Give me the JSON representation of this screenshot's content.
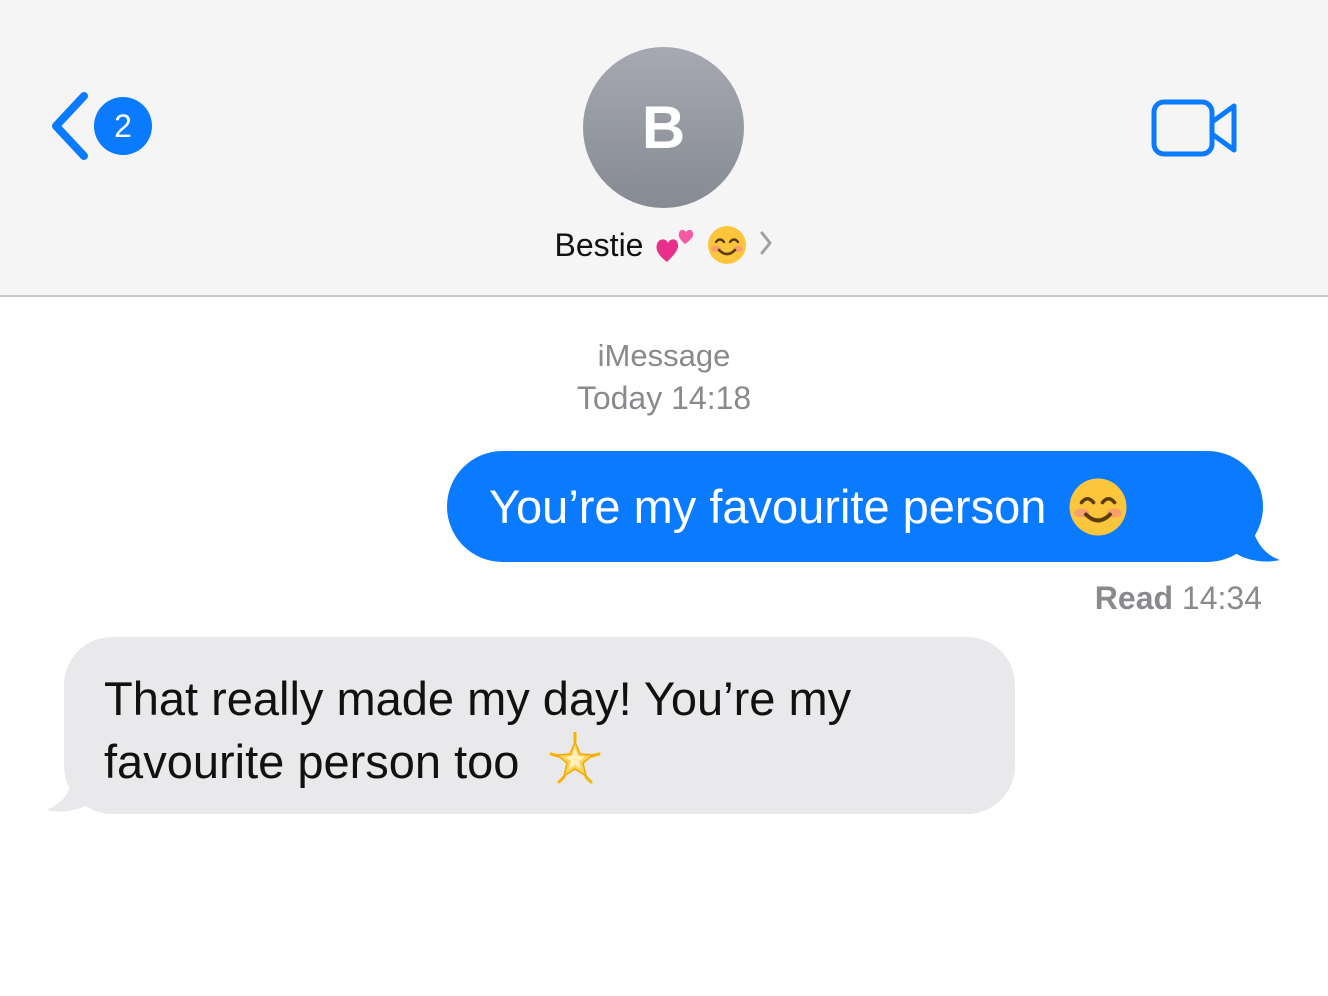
{
  "header": {
    "back_badge_count": "2",
    "avatar_initial": "B",
    "contact_name": "Bestie",
    "contact_emojis": [
      "two-hearts-emoji",
      "smiling-face-emoji"
    ],
    "icons": [
      "chevron-left-icon",
      "chevron-right-icon",
      "video-camera-icon"
    ],
    "accent_color": "#0a7aff"
  },
  "conversation": {
    "service_label": "iMessage",
    "timestamp": "Today 14:18",
    "messages": [
      {
        "direction": "sent",
        "text": "You’re my favourite person",
        "emoji": "smiling-face-emoji",
        "bubble_color": "#0a7aff"
      },
      {
        "direction": "received",
        "line1": "That really made my day! You’re my",
        "line2": "favourite person too",
        "emoji": "glowing-star-emoji",
        "bubble_color": "#e9e9eb"
      }
    ],
    "read_receipt": {
      "label": "Read",
      "time": "14:34"
    }
  }
}
